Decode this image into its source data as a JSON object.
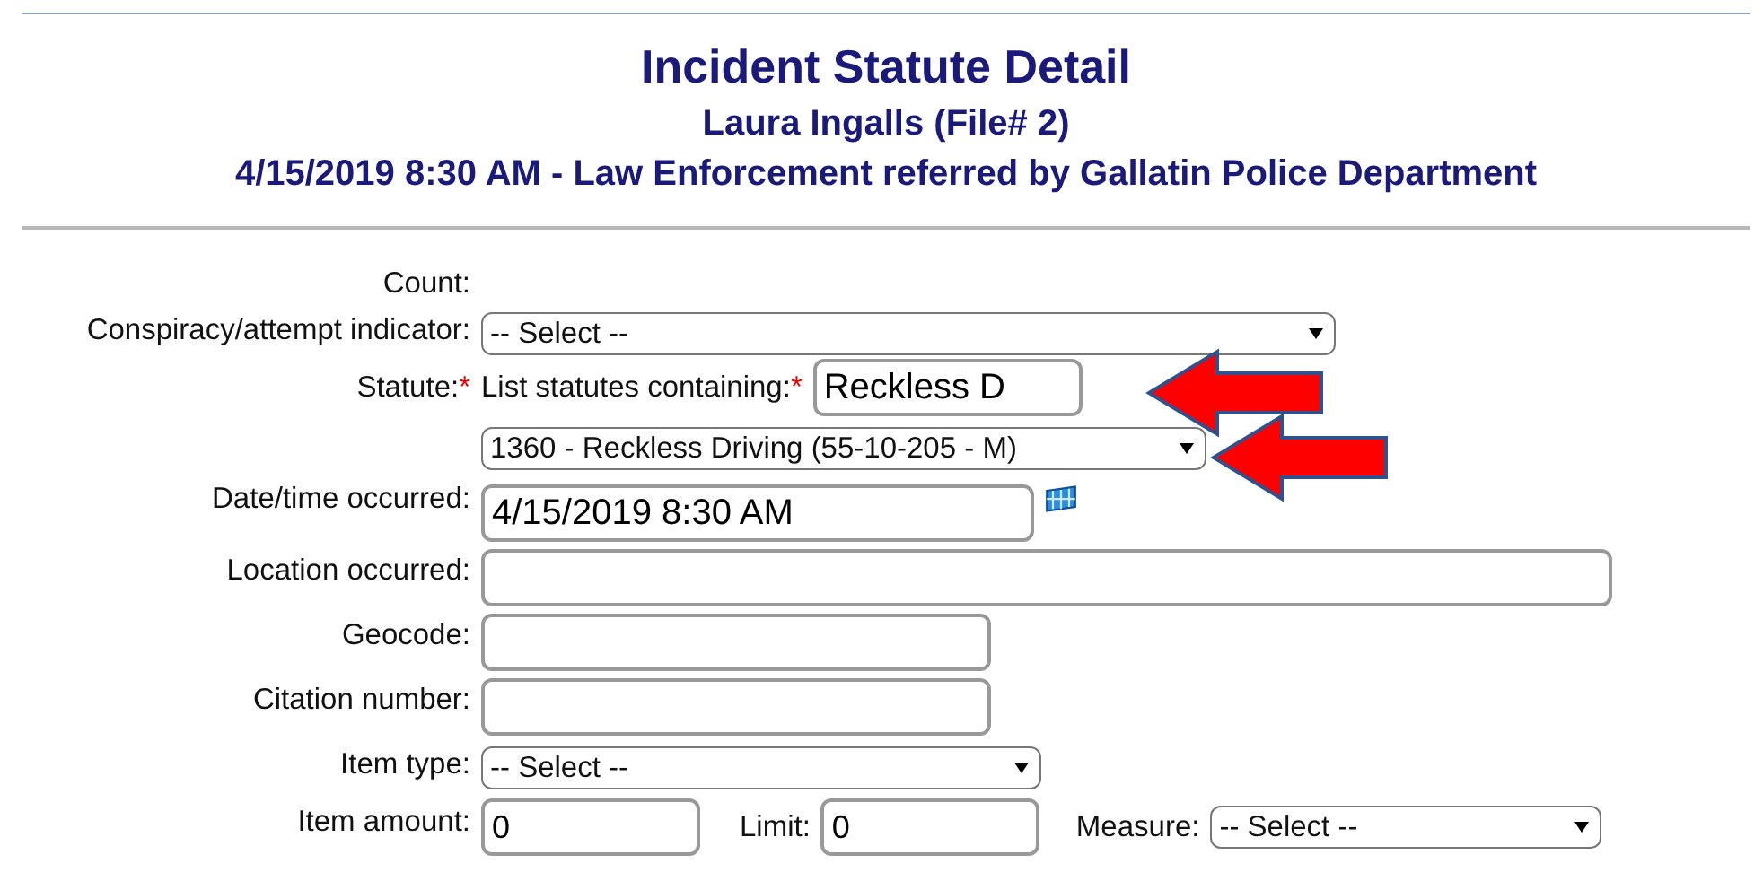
{
  "header": {
    "title": "Incident Statute Detail",
    "subtitle": "Laura Ingalls (File# 2)",
    "detail": "4/15/2019 8:30 AM - Law Enforcement referred by Gallatin Police Department"
  },
  "form": [
    {
      "kind": "text",
      "label": "Count:"
    },
    {
      "kind": "wide_select",
      "label": "Conspiracy/attempt indicator:",
      "value": "-- Select --"
    },
    {
      "kind": "statute",
      "label": "Statute:",
      "required_mark": "*",
      "search_label": "List statutes containing:",
      "search_required_mark": "*",
      "search_value": "Reckless D"
    },
    {
      "kind": "statute_select",
      "value": "1360 - Reckless Driving (55-10-205 - M)"
    },
    {
      "kind": "date",
      "label": "Date/time occurred:",
      "value": "4/15/2019 8:30 AM"
    },
    {
      "kind": "wide_input",
      "label": "Location occurred:"
    },
    {
      "kind": "short_input",
      "label": "Geocode:"
    },
    {
      "kind": "short_input",
      "label": "Citation number:"
    },
    {
      "kind": "short_select",
      "label": "Item type:",
      "value": "-- Select --"
    },
    {
      "kind": "amount",
      "label": "Item amount:",
      "value": "0",
      "limit_label": "Limit:",
      "limit_value": "0",
      "measure_label": "Measure:",
      "measure_value": "-- Select --"
    }
  ]
}
